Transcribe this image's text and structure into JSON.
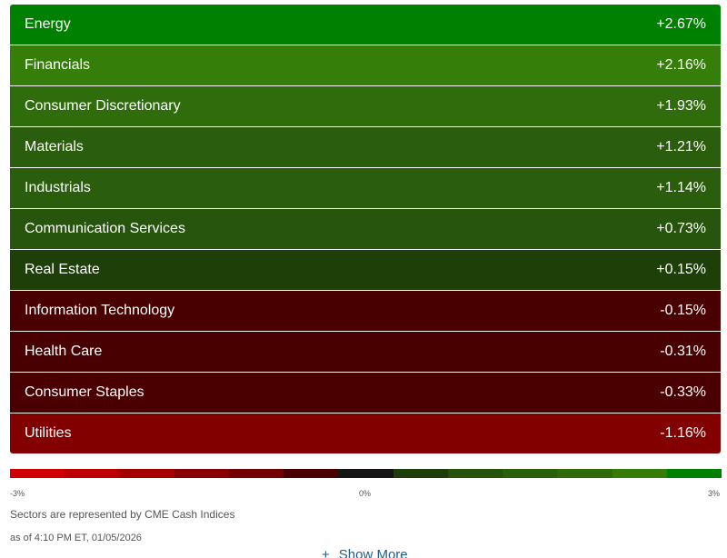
{
  "sectors": [
    {
      "name": "Energy",
      "change": "+2.67%",
      "color": "#008000"
    },
    {
      "name": "Financials",
      "change": "+2.16%",
      "color": "#367e0a"
    },
    {
      "name": "Consumer Discretionary",
      "change": "+1.93%",
      "color": "#2f6d0c"
    },
    {
      "name": "Materials",
      "change": "+1.21%",
      "color": "#2b5e0c"
    },
    {
      "name": "Industrials",
      "change": "+1.14%",
      "color": "#2b5e0c"
    },
    {
      "name": "Communication Services",
      "change": "+0.73%",
      "color": "#27550d"
    },
    {
      "name": "Real Estate",
      "change": "+0.15%",
      "color": "#1e3f08"
    },
    {
      "name": "Information Technology",
      "change": "-0.15%",
      "color": "#480000"
    },
    {
      "name": "Health Care",
      "change": "-0.31%",
      "color": "#480000"
    },
    {
      "name": "Consumer Staples",
      "change": "-0.33%",
      "color": "#4a0000"
    },
    {
      "name": "Utilities",
      "change": "-1.16%",
      "color": "#820000"
    }
  ],
  "scale": {
    "colors": [
      "#d00000",
      "#bc0000",
      "#a50000",
      "#8a0000",
      "#720000",
      "#4a0000",
      "#151515",
      "#1d3d0a",
      "#24520b",
      "#2a600a",
      "#2f6b09",
      "#377c06",
      "#008000"
    ],
    "min_label": "-3%",
    "mid_label": "0%",
    "max_label": "3%"
  },
  "notes": {
    "source": "Sectors are represented by CME Cash Indices",
    "timestamp": "as of 4:10 PM ET, 01/05/2026"
  },
  "show_more": {
    "label": "Show More",
    "icon": "plus-icon"
  }
}
